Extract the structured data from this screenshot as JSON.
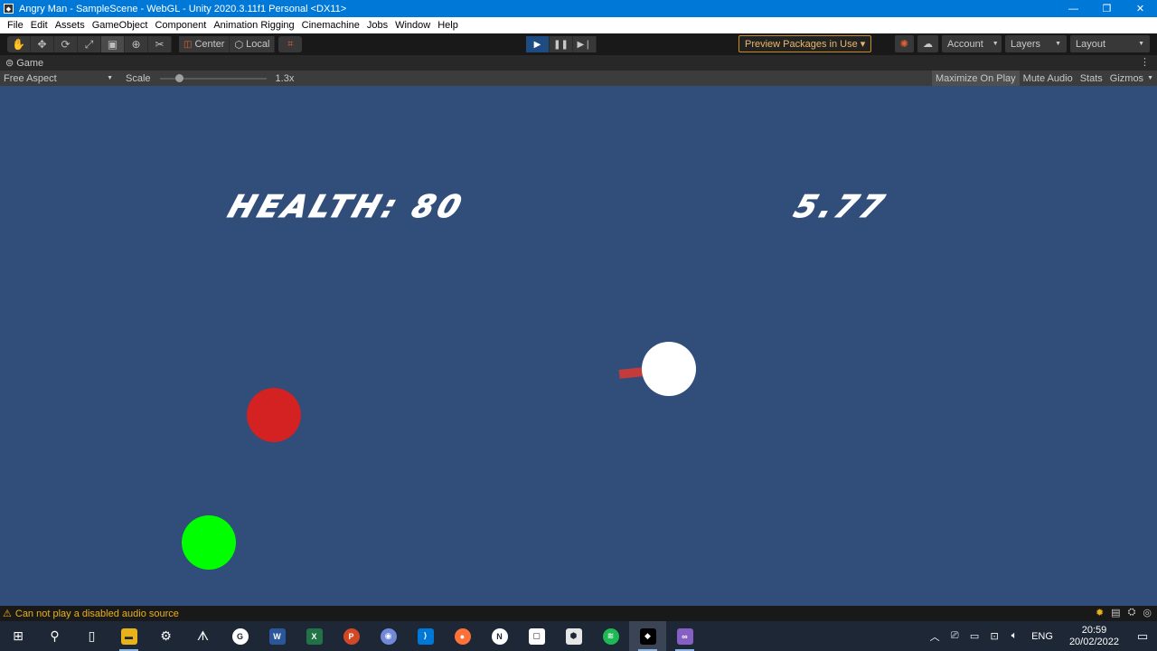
{
  "window": {
    "title": "Angry Man - SampleScene - WebGL - Unity 2020.3.11f1 Personal <DX11>",
    "minimize": "—",
    "maximize": "❐",
    "close": "✕"
  },
  "menubar": {
    "items": [
      "File",
      "Edit",
      "Assets",
      "GameObject",
      "Component",
      "Animation Rigging",
      "Cinemachine",
      "Jobs",
      "Window",
      "Help"
    ]
  },
  "toolbar": {
    "tools": [
      "hand-tool-icon",
      "move-tool-icon",
      "rotate-tool-icon",
      "scale-tool-icon",
      "rect-tool-icon",
      "transform-tool-icon",
      "custom-tool-icon"
    ],
    "pivot_center": "Center",
    "pivot_local": "Local",
    "preview_packages": "Preview Packages in Use",
    "account": "Account",
    "layers": "Layers",
    "layout": "Layout"
  },
  "game_tab": {
    "label": "Game",
    "aspect": "Free Aspect",
    "scale_label": "Scale",
    "scale_value": "1.3x",
    "maximize_on_play": "Maximize On Play",
    "mute_audio": "Mute Audio",
    "stats": "Stats",
    "gizmos": "Gizmos"
  },
  "game": {
    "health_text": "HEALTH: 80",
    "timer_text": "5.77",
    "colors": {
      "background": "#314d79",
      "enemy": "#d42121",
      "player_green": "#00ff00",
      "player_white": "#ffffff",
      "gun": "#c43b3b"
    }
  },
  "status": {
    "message": "Can not play a disabled audio source"
  },
  "taskbar": {
    "apps": [
      "windows-start-icon",
      "search-icon",
      "task-view-icon",
      "file-explorer-icon",
      "steam-icon",
      "predator-sense-icon",
      "logitech-g-icon",
      "word-icon",
      "excel-icon",
      "powerpoint-icon",
      "discord-icon",
      "vscode-icon",
      "firefox-icon",
      "notion-icon",
      "twitch-icon",
      "unity-hub-icon",
      "spotify-icon",
      "unity-icon",
      "visual-studio-icon"
    ],
    "language": "ENG",
    "time": "20:59",
    "date": "20/02/2022"
  }
}
